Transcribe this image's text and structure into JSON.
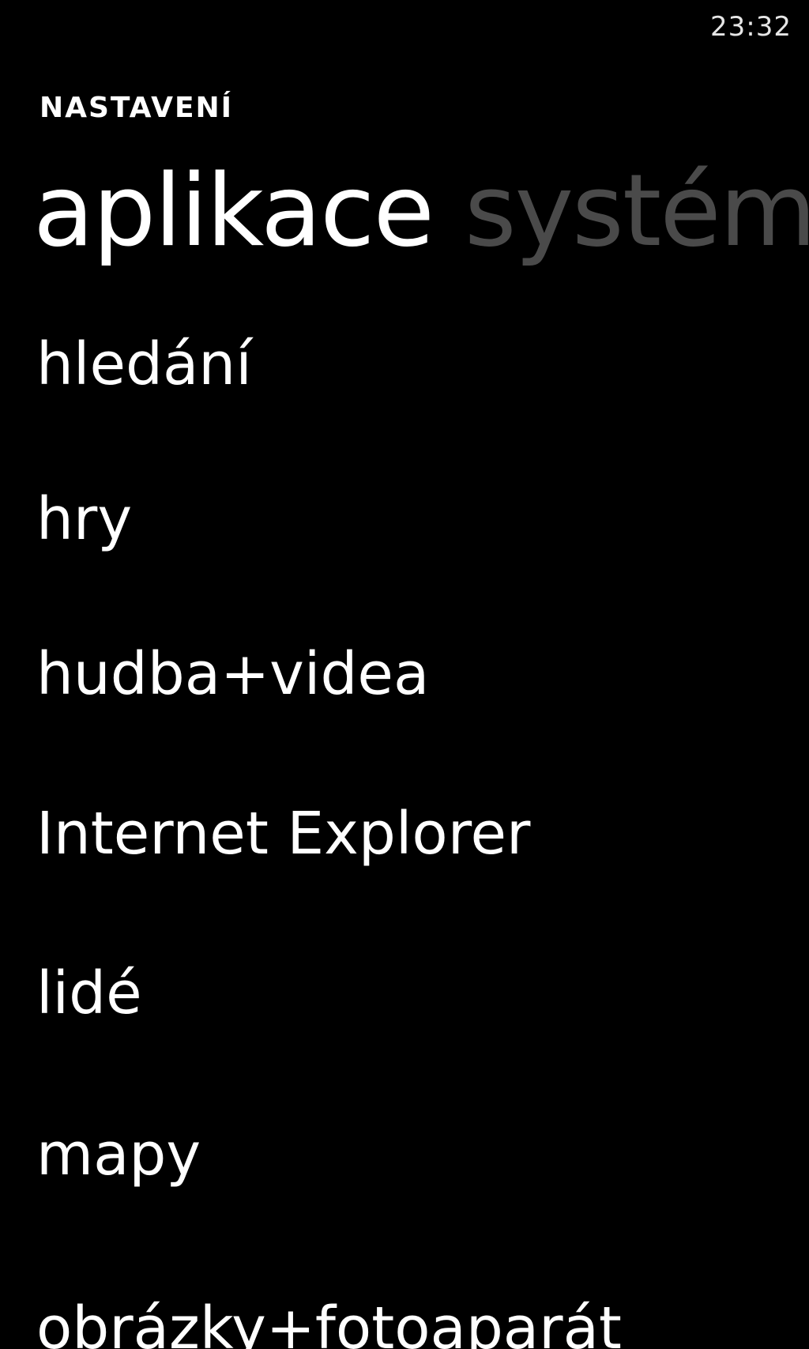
{
  "status_bar": {
    "time": "23:32"
  },
  "app": {
    "title": "NASTAVENÍ"
  },
  "pivot": {
    "items": [
      {
        "label": "aplikace",
        "active": true
      },
      {
        "label": "systém",
        "active": false
      }
    ]
  },
  "settings_list": {
    "items": [
      {
        "label": "hledání"
      },
      {
        "label": "hry"
      },
      {
        "label": "hudba+videa"
      },
      {
        "label": "Internet Explorer"
      },
      {
        "label": "lidé"
      },
      {
        "label": "mapy"
      },
      {
        "label": "obrázky+fotoaparát"
      }
    ]
  },
  "colors": {
    "background": "#000000",
    "text_active": "#ffffff",
    "text_inactive": "#4a4a4a"
  }
}
